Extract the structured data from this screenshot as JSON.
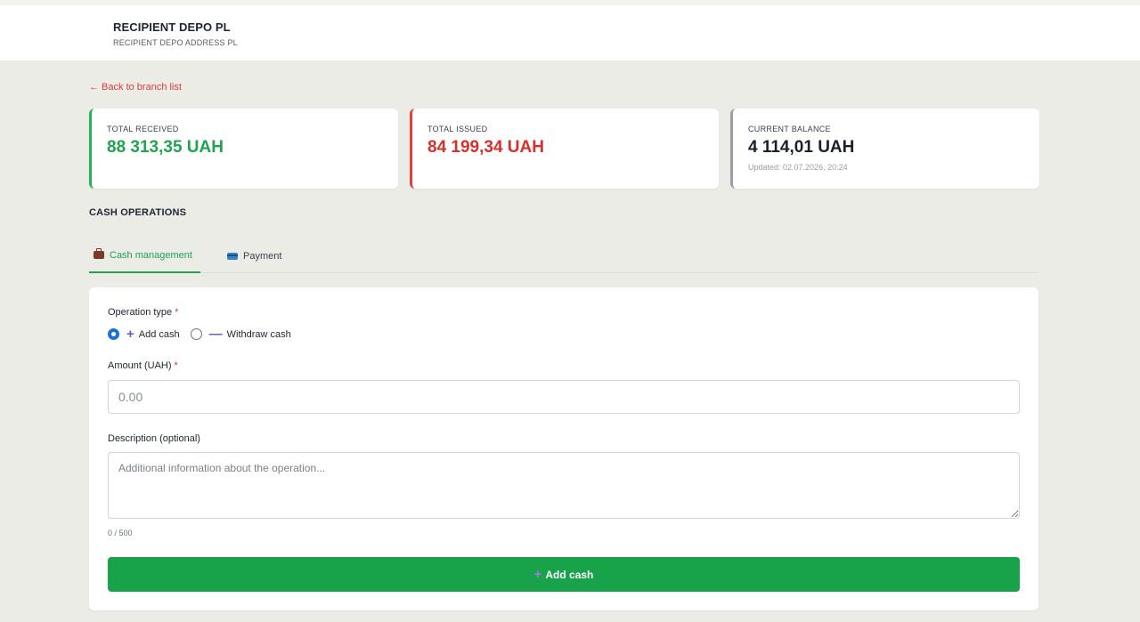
{
  "header": {
    "title": "RECIPIENT DEPO PL",
    "subtitle": "RECIPIENT DEPO ADDRESS PL"
  },
  "back_link": "← Back to branch list",
  "stats": {
    "received": {
      "label": "TOTAL RECEIVED",
      "value": "88 313,35 UAH",
      "accent": "#22b45a"
    },
    "issued": {
      "label": "TOTAL ISSUED",
      "value": "84 199,34 UAH",
      "accent": "#e0433a"
    },
    "balance": {
      "label": "CURRENT BALANCE",
      "value": "4 114,01 UAH",
      "updated": "Updated: 02.07.2026, 20:24",
      "accent": "#9aa0a8"
    }
  },
  "section_title": "CASH OPERATIONS",
  "tabs": [
    {
      "label": "Cash management",
      "icon": "briefcase-icon",
      "active": true
    },
    {
      "label": "Payment",
      "icon": "credit-card-icon",
      "active": false
    }
  ],
  "form": {
    "operation_type_label": "Operation type",
    "required_mark": "*",
    "options": [
      {
        "symbol": "+",
        "label": "Add cash",
        "selected": true
      },
      {
        "symbol": "—",
        "label": "Withdraw cash",
        "selected": false
      }
    ],
    "amount_label": "Amount (UAH)",
    "amount_placeholder": "0.00",
    "description_label": "Description (optional)",
    "description_placeholder": "Additional information about the operation...",
    "counter": "0 / 500",
    "submit_symbol": "+",
    "submit_label": "Add cash",
    "submit_color": "#18a34b"
  }
}
